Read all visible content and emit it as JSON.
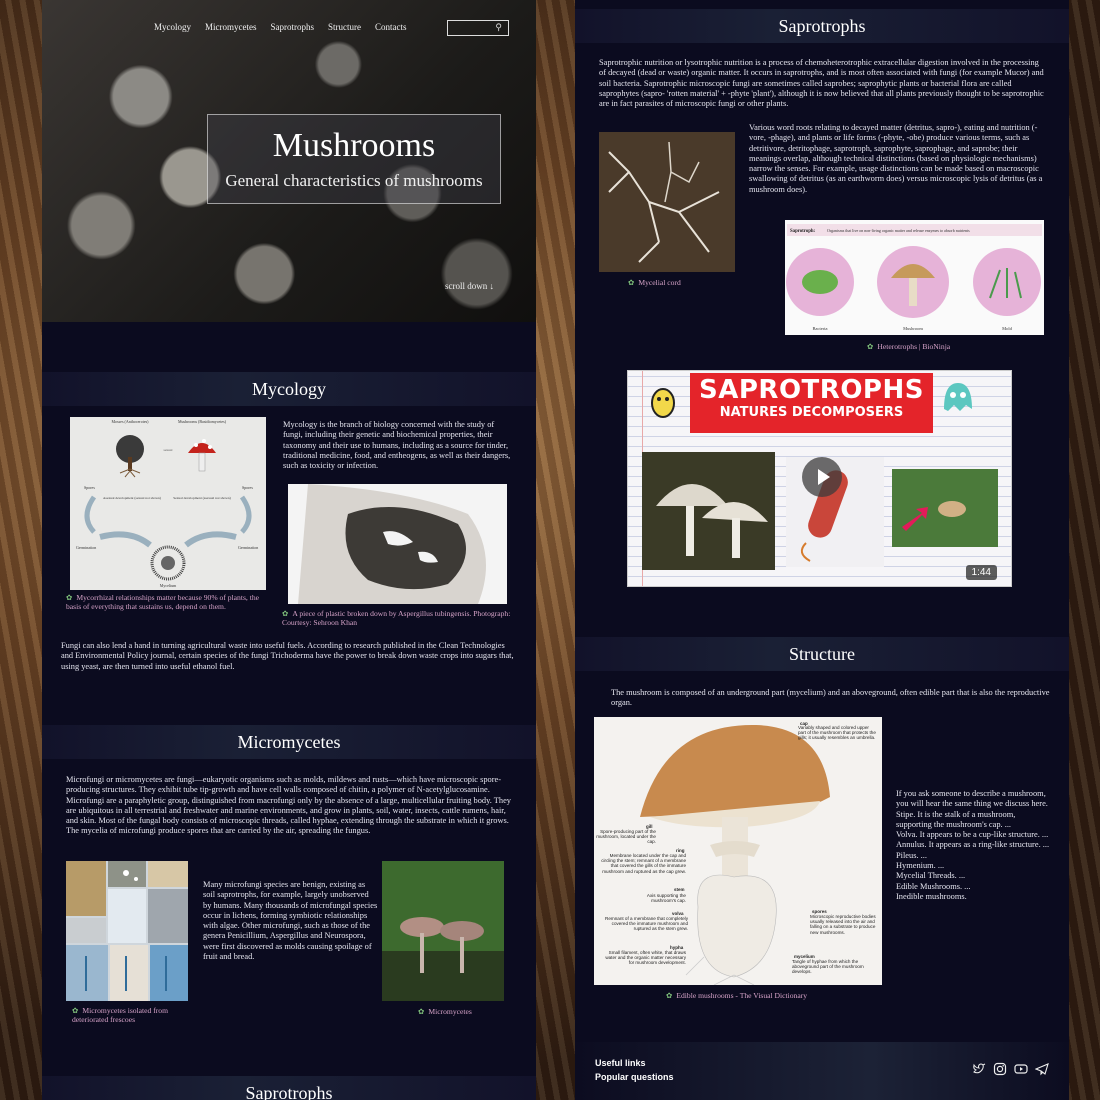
{
  "nav": {
    "items": [
      "Mycology",
      "Micromycetes",
      "Saprotrophs",
      "Structure",
      "Contacts"
    ]
  },
  "hero": {
    "title": "Mushrooms",
    "subtitle": "General characteristics of mushrooms",
    "scroll_label": "scroll down"
  },
  "mycology": {
    "heading": "Mycology",
    "intro": "Mycology is the branch of biology concerned with the study of fungi, including their genetic and biochemical properties, their taxonomy and their use to humans, including as a source for tinder, traditional medicine, food, and entheogens, as well as their dangers, such as toxicity or infection.",
    "diagram": {
      "top_left": "Mosses (Anthocerotes)",
      "top_right": "Mushrooms (Basidiomycetes)",
      "left_spores": "Spores",
      "right_spores": "Spores",
      "left_dev": "Asexual development (sexual not shown)",
      "right_dev": "Sexual development (asexual not shown)",
      "germ_left": "Germination",
      "germ_right": "Germination",
      "bottom": "Mycelium",
      "center_label": "sexual"
    },
    "caption1": "Mycorrhizal relationships matter because 90% of plants, the basis of everything that sustains us, depend on them.",
    "caption2": "A piece of plastic broken down by Aspergillus tubingensis. Photograph: Courtesy: Sehroon Khan",
    "body": "Fungi can also lend a hand in turning agricultural waste into useful fuels. According to research published in the Clean Technologies and Environmental Policy journal, certain species of the fungi Trichoderma have the power to break down waste crops into sugars that, using yeast, are then turned into useful ethanol fuel."
  },
  "micromycetes": {
    "heading": "Micromycetes",
    "intro": "Microfungi or micromycetes are fungi—eukaryotic organisms such as molds, mildews and rusts—which have microscopic spore-producing structures. They exhibit tube tip-growth and have cell walls composed of chitin, a polymer of N-acetylglucosamine. Microfungi are a paraphyletic group, distinguished from macrofungi only by the absence of a large, multicellular fruiting body. They are ubiquitous in all terrestrial and freshwater and marine environments, and grow in plants, soil, water, insects, cattle rumens, hair, and skin. Most of the fungal body consists of microscopic threads, called hyphae, extending through the substrate in which it grows. The mycelia of microfungi produce spores that are carried by the air, spreading the fungus.",
    "body": "Many microfungi species are benign, existing as soil saprotrophs, for example, largely unobserved by humans. Many thousands of microfungal species occur in lichens, forming symbiotic relationships with algae. Other microfungi, such as those of the genera Penicillium, Aspergillus and Neurospora, were first discovered as molds causing spoilage of fruit and bread.",
    "caption1": "Micromycetes isolated from deteriorated frescoes",
    "caption2": "Micromycetes"
  },
  "next_heading_partial": "Saprotrophs",
  "saprotrophs": {
    "heading": "Saprotrophs",
    "intro": "Saprotrophic nutrition or lysotrophic nutrition is a process of chemoheterotrophic extracellular digestion involved in the processing of decayed (dead or waste) organic matter. It occurs in saprotrophs, and is most often associated with fungi (for example Mucor) and soil bacteria. Saprotrophic microscopic fungi are sometimes called saprobes; saprophytic plants or bacterial flora are called saprophytes (sapro- 'rotten material' + -phyte 'plant'), although it is now believed that all plants previously thought to be saprotrophic are in fact parasites of microscopic fungi or other plants.",
    "body": "Various word roots relating to decayed matter (detritus, sapro-), eating and nutrition (-vore, -phage), and plants or life forms (-phyte, -obe) produce various terms, such as detritivore, detritophage, saprotroph, saprophyte, saprophage, and saprobe; their meanings overlap, although technical distinctions (based on physiologic mechanisms) narrow the senses. For example, usage distinctions can be made based on macroscopic swallowing of detritus (as an earthworm does) versus microscopic lysis of detritus (as a mushroom does).",
    "caption1": "Mycelial cord",
    "infographic": {
      "title": "Saprotroph:",
      "desc": "Organisms that live on non-living organic matter and release enzymes to absorb nutrients",
      "labels": [
        "Bacteria",
        "Mushroom",
        "Mold"
      ]
    },
    "caption2": "Heterotrophs | BioNinja",
    "video": {
      "title": "SAPROTROPHS",
      "subtitle": "NATURES DECOMPOSERS",
      "duration": "1:44"
    }
  },
  "structure": {
    "heading": "Structure",
    "intro": "The mushroom is composed of an underground part (mycelium) and an aboveground, often edible part that is also the reproductive organ.",
    "labels": {
      "cap_title": "cap",
      "cap": "Variably shaped and colored upper part of the mushroom that protects the gills; it usually resembles an umbrella.",
      "gill_title": "gill",
      "gill": "Spore-producing part of the mushroom, located under the cap.",
      "ring_title": "ring",
      "ring": "Membrane located under the cap and circling the stem; remnant of a membrane that covered the gills of the immature mushroom and ruptured as the cap grew.",
      "stem_title": "stem",
      "stem": "Axis supporting the mushroom's cap.",
      "volva_title": "volva",
      "volva": "Remnant of a membrane that completely covered the immature mushroom and ruptured as the stem grew.",
      "hypha_title": "hypha",
      "hypha": "Small filament, often white, that draws water and the organic matter necessary for mushroom development.",
      "spores_title": "spores",
      "spores": "Microscopic reproductive bodies usually released into the air and falling on a substrate to produce new mushrooms.",
      "mycelium_title": "mycelium",
      "mycelium": "Tangle of hyphae from which the aboveground part of the mushroom develops."
    },
    "list": [
      "If you ask someone to describe a mushroom, you will hear the same thing we discuss here.",
      "Stipe. It is the stalk of a mushroom, supporting the mushroom's cap. ...",
      "Volva. It appears to be a cup-like structure. ...",
      "Annulus. It appears as a ring-like structure. ...",
      "Pileus. ...",
      "Hymenium. ...",
      "Mycelial Threads. ...",
      "Edible Mushrooms. ...",
      "Inedible mushrooms."
    ],
    "caption": "Edible mushrooms - The Visual Dictionary"
  },
  "footer": {
    "useful_links": "Useful links",
    "popular_questions": "Popular questions",
    "icons": [
      "twitter-icon",
      "instagram-icon",
      "youtube-icon",
      "telegram-icon"
    ]
  }
}
